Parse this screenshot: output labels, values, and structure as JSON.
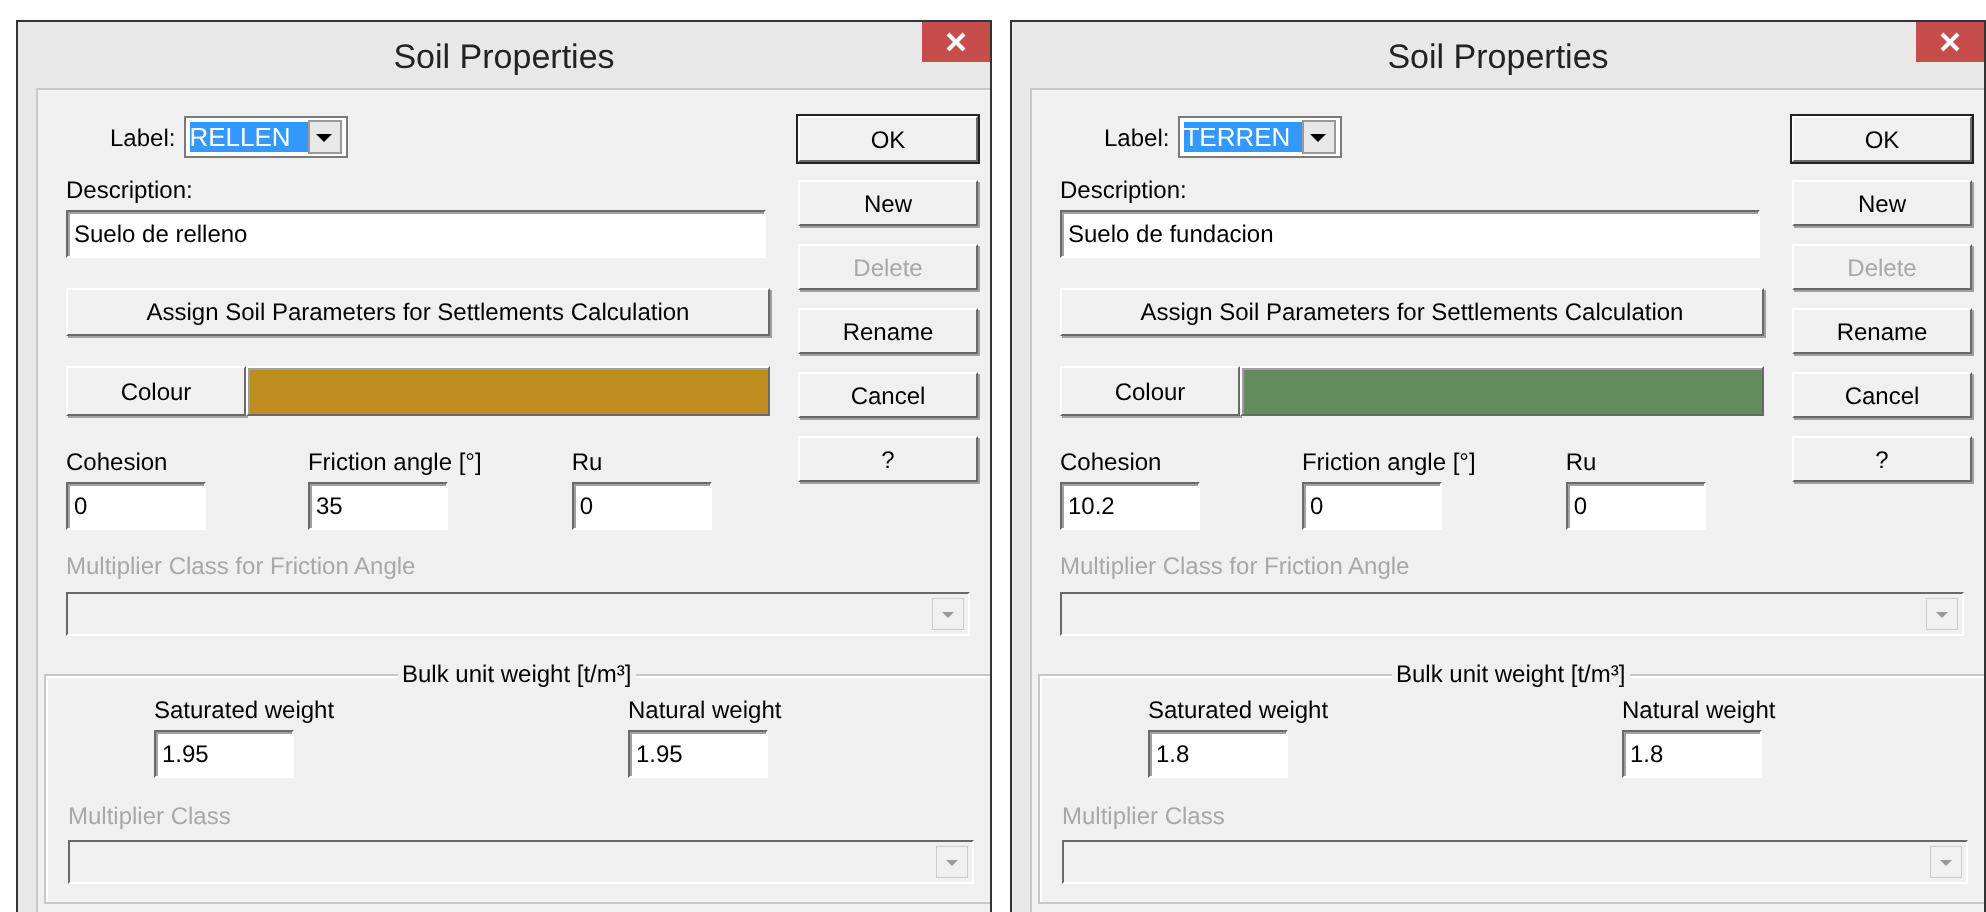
{
  "dialogs": [
    {
      "title": "Soil Properties",
      "label": {
        "caption": "Label:",
        "value": "RELLEN"
      },
      "description": {
        "caption": "Description:",
        "value": "Suelo de relleno"
      },
      "assign_button": "Assign Soil Parameters for Settlements Calculation",
      "colour": {
        "button": "Colour",
        "color": "#bf8c22"
      },
      "params": [
        {
          "label": "Cohesion",
          "value": "0"
        },
        {
          "label": "Friction angle [°]",
          "value": "35"
        },
        {
          "label": "Ru",
          "value": "0"
        }
      ],
      "friction_multiplier": {
        "label": "Multiplier Class for Friction Angle",
        "disabled": true
      },
      "bulk": {
        "legend": "Bulk unit weight [t/m³]",
        "fields": [
          {
            "label": "Saturated weight",
            "value": "1.95"
          },
          {
            "label": "Natural weight",
            "value": "1.95"
          }
        ],
        "multiplier": {
          "label": "Multiplier Class",
          "disabled": true
        }
      },
      "buttons": [
        {
          "label": "OK",
          "disabled": false,
          "default": true
        },
        {
          "label": "New",
          "disabled": false,
          "default": false
        },
        {
          "label": "Delete",
          "disabled": true,
          "default": false
        },
        {
          "label": "Rename",
          "disabled": false,
          "default": false
        },
        {
          "label": "Cancel",
          "disabled": false,
          "default": false
        },
        {
          "label": "?",
          "disabled": false,
          "default": false
        }
      ]
    },
    {
      "title": "Soil Properties",
      "label": {
        "caption": "Label:",
        "value": "TERREN"
      },
      "description": {
        "caption": "Description:",
        "value": "Suelo de fundacion"
      },
      "assign_button": "Assign Soil Parameters for Settlements Calculation",
      "colour": {
        "button": "Colour",
        "color": "#648c5f"
      },
      "params": [
        {
          "label": "Cohesion",
          "value": "10.2"
        },
        {
          "label": "Friction angle [°]",
          "value": "0"
        },
        {
          "label": "Ru",
          "value": "0"
        }
      ],
      "friction_multiplier": {
        "label": "Multiplier Class for Friction Angle",
        "disabled": true
      },
      "bulk": {
        "legend": "Bulk unit weight [t/m³]",
        "fields": [
          {
            "label": "Saturated weight",
            "value": "1.8"
          },
          {
            "label": "Natural weight",
            "value": "1.8"
          }
        ],
        "multiplier": {
          "label": "Multiplier Class",
          "disabled": true
        }
      },
      "buttons": [
        {
          "label": "OK",
          "disabled": false,
          "default": true
        },
        {
          "label": "New",
          "disabled": false,
          "default": false
        },
        {
          "label": "Delete",
          "disabled": true,
          "default": false
        },
        {
          "label": "Rename",
          "disabled": false,
          "default": false
        },
        {
          "label": "Cancel",
          "disabled": false,
          "default": false
        },
        {
          "label": "?",
          "disabled": false,
          "default": false
        }
      ]
    }
  ]
}
